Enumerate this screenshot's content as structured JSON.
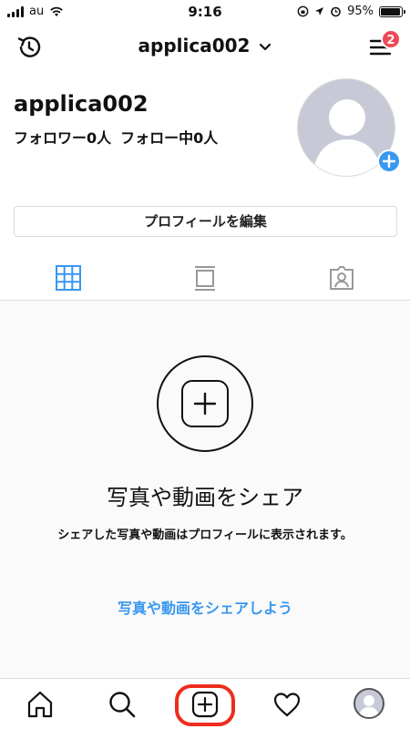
{
  "status_bar": {
    "carrier": "au",
    "time": "9:16",
    "battery": "95%",
    "battery_level": 0.95
  },
  "header": {
    "title": "applica002",
    "menu_badge": "2",
    "icons": [
      "history-icon",
      "chevron-down-icon",
      "menu-icon"
    ]
  },
  "profile": {
    "username": "applica002",
    "followers": "フォロワー0人",
    "following": "フォロー中0人",
    "edit_button": "プロフィールを編集"
  },
  "tabs": [
    "grid-icon",
    "feed-icon",
    "tagged-icon"
  ],
  "empty_state": {
    "title": "写真や動画をシェア",
    "description": "シェアした写真や動画はプロフィールに表示されます。",
    "link": "写真や動画をシェアしよう"
  },
  "bottom_nav": [
    "home-icon",
    "search-icon",
    "new-post-icon",
    "heart-icon",
    "profile-avatar"
  ],
  "colors": {
    "accent": "#3897f0",
    "badge": "#ed4956",
    "highlight": "#ee2c1d"
  }
}
